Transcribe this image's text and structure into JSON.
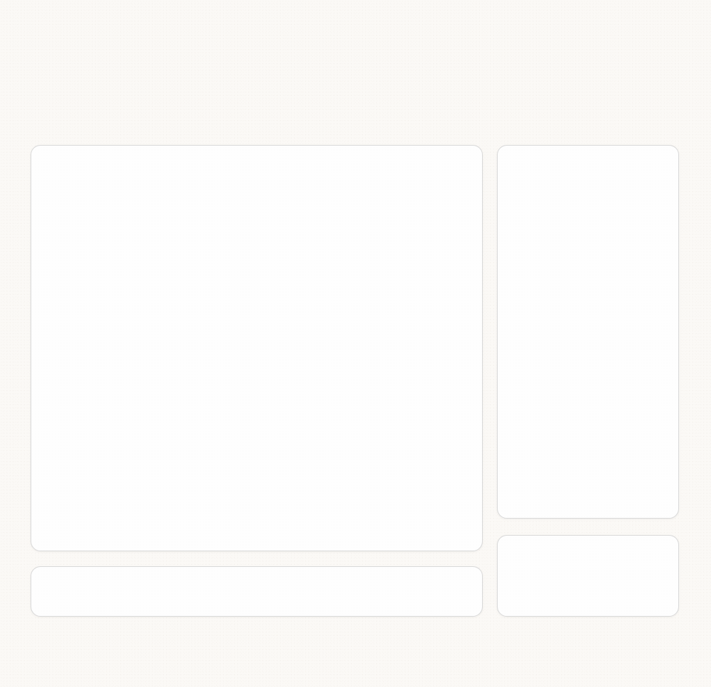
{
  "theme": {
    "background_color": "#fbf9f6",
    "panel_color": "#fefefe",
    "panel_border_color": "#d9d9d9"
  },
  "panels": {
    "main": {},
    "bottom_bar": {},
    "side": {},
    "side_bottom": {}
  }
}
